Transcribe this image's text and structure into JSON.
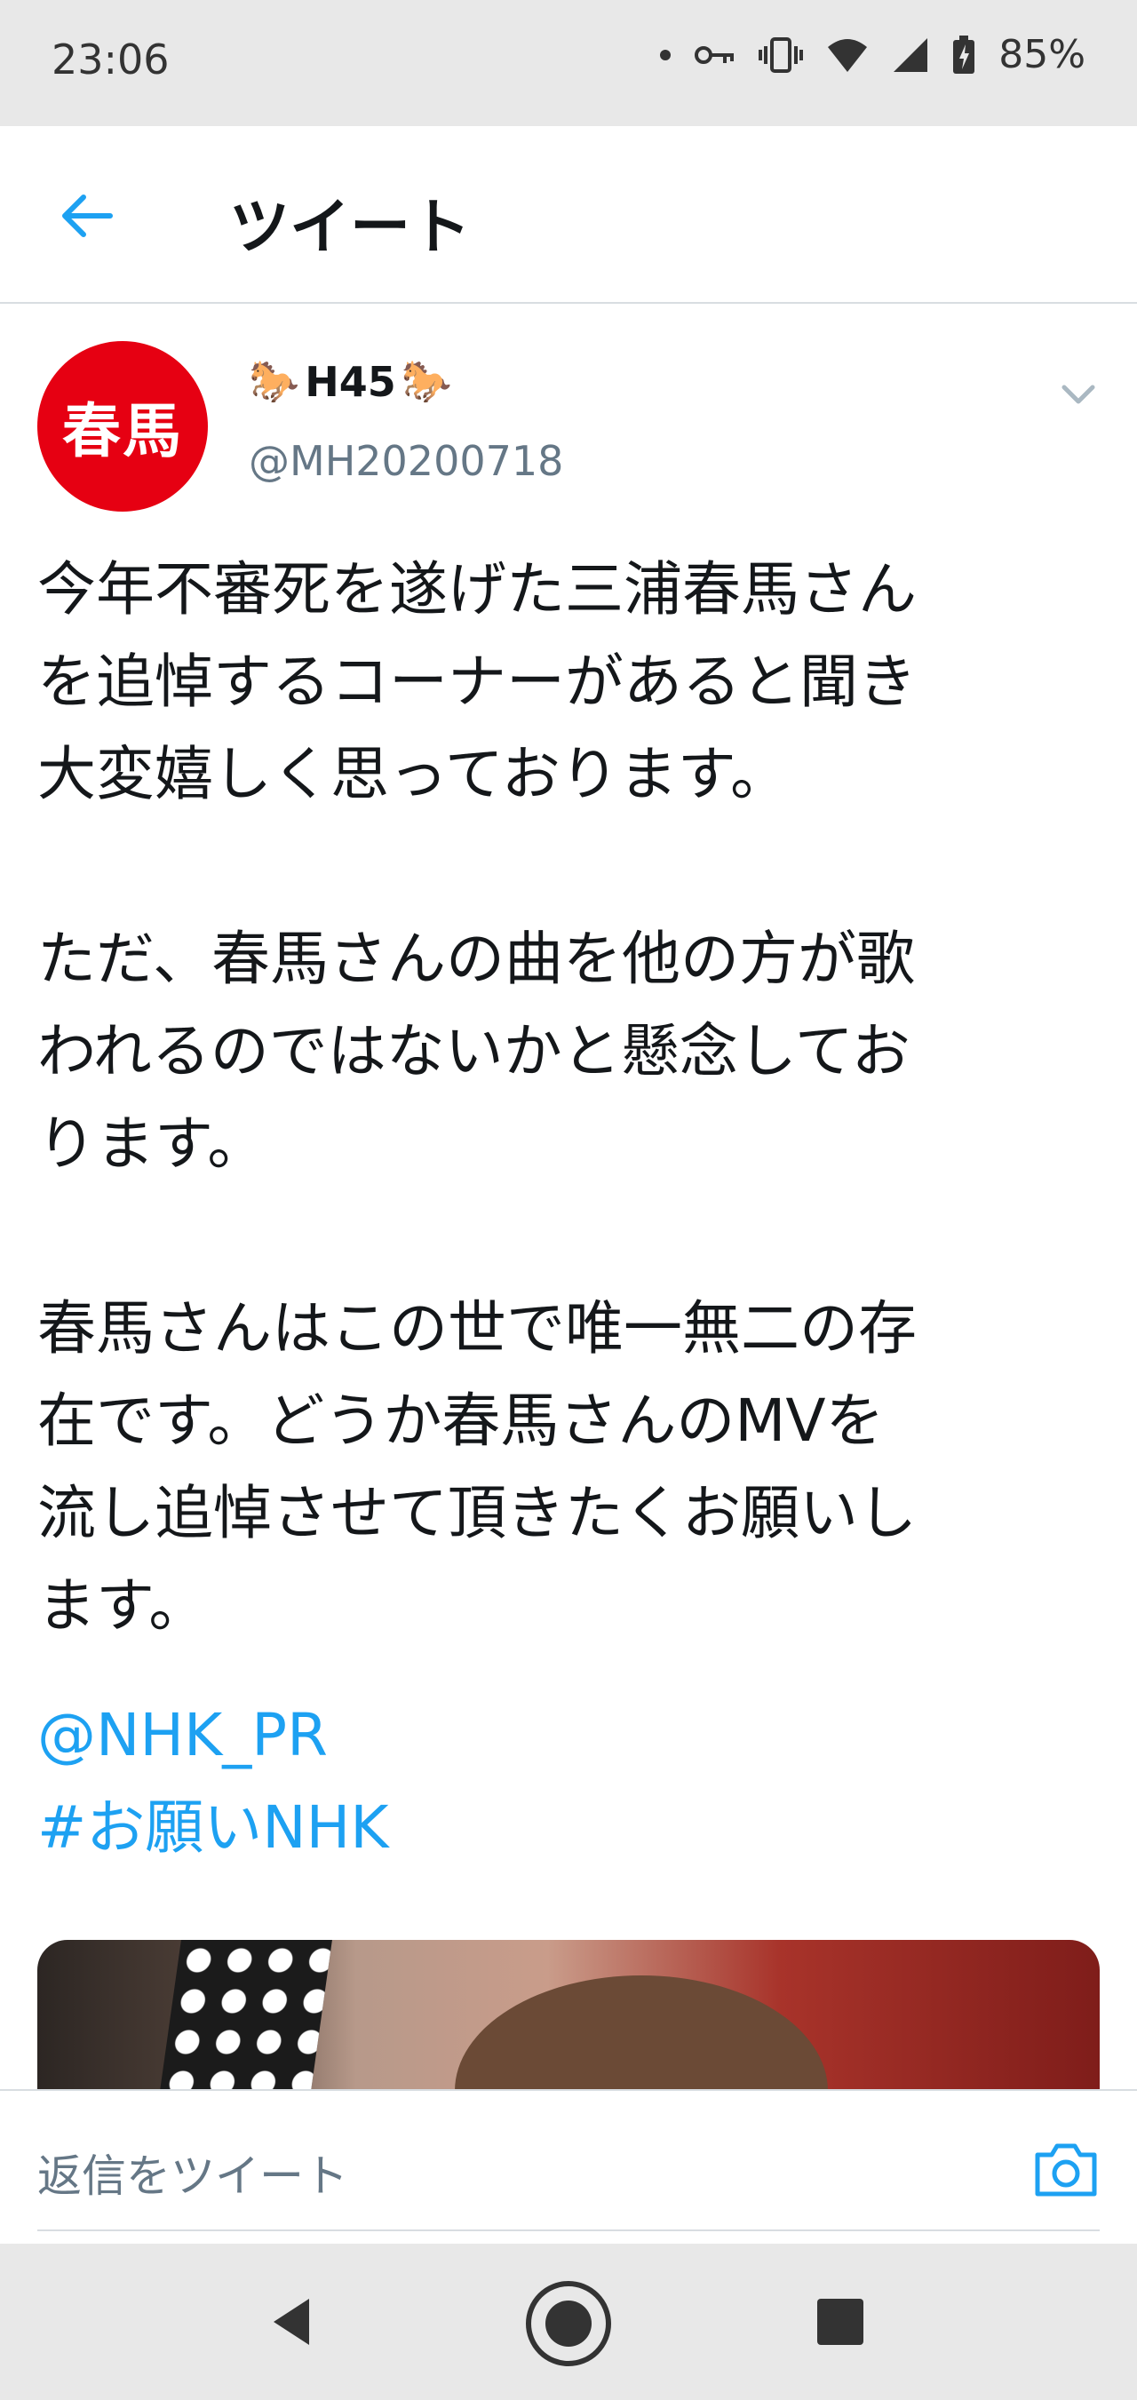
{
  "status_bar": {
    "time": "23:06",
    "battery_percent": "85%",
    "icons": [
      "dot-icon",
      "key-icon",
      "vibrate-icon",
      "wifi-icon",
      "signal-icon",
      "battery-icon"
    ]
  },
  "app_bar": {
    "title": "ツイート",
    "back_icon": "back-arrow-icon"
  },
  "tweet": {
    "avatar_text": "春馬",
    "display_name": "H45",
    "name_emoji": "🐎",
    "handle": "@MH20200718",
    "body": "今年不審死を遂げた三浦春馬さん\nを追悼するコーナーがあると聞き\n大変嬉しく思っております。\n\nただ、春馬さんの曲を他の方が歌\nわれるのではないかと懸念してお\nります。\n\n春馬さんはこの世で唯一無二の存\n在です。どうか春馬さんのMVを\n流し追悼させて頂きたくお願いし\nます。",
    "mention": "@NHK_PR",
    "hashtag": "#お願いNHK"
  },
  "reply": {
    "placeholder": "返信をツイート"
  },
  "colors": {
    "accent": "#1da1f2",
    "avatar_bg": "#e60012",
    "secondary_text": "#657786"
  }
}
